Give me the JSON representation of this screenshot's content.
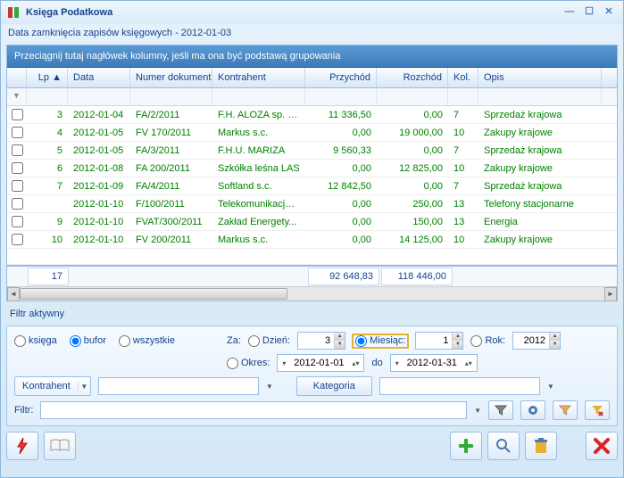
{
  "title": "Księga Podatkowa",
  "subtitle": "Data zamknięcia zapisów księgowych - 2012-01-03",
  "group_hint": "Przeciągnij tutaj nagłówek kolumny, jeśli ma ona być podstawą grupowania",
  "columns": {
    "lp": "Lp",
    "data": "Data",
    "numer": "Numer dokumentu",
    "kontrahent": "Kontrahent",
    "przychod": "Przychód",
    "rozchod": "Rozchód",
    "kol": "Kol.",
    "opis": "Opis"
  },
  "rows": [
    {
      "lp": "3",
      "data": "2012-01-04",
      "num": "FA/2/2011",
      "kon": "F.H. ALOZA sp. z...",
      "prz": "11 336,50",
      "roz": "0,00",
      "kol": "7",
      "opis": "Sprzedaż krajowa"
    },
    {
      "lp": "4",
      "data": "2012-01-05",
      "num": "FV 170/2011",
      "kon": "Markus s.c.",
      "prz": "0,00",
      "roz": "19 000,00",
      "kol": "10",
      "opis": "Zakupy krajowe"
    },
    {
      "lp": "5",
      "data": "2012-01-05",
      "num": "FA/3/2011",
      "kon": "F.H.U. MARIZA",
      "prz": "9 560,33",
      "roz": "0,00",
      "kol": "7",
      "opis": "Sprzedaż krajowa"
    },
    {
      "lp": "6",
      "data": "2012-01-08",
      "num": "FA 200/2011",
      "kon": "Szkółka leśna LAS",
      "prz": "0,00",
      "roz": "12 825,00",
      "kol": "10",
      "opis": "Zakupy krajowe"
    },
    {
      "lp": "7",
      "data": "2012-01-09",
      "num": "FA/4/2011",
      "kon": "Softland s.c.",
      "prz": "12 842,50",
      "roz": "0,00",
      "kol": "7",
      "opis": "Sprzedaż krajowa"
    },
    {
      "lp": "",
      "data": "2012-01-10",
      "num": "F/100/2011",
      "kon": "Telekomunikacja ...",
      "prz": "0,00",
      "roz": "250,00",
      "kol": "13",
      "opis": "Telefony stacjonarne"
    },
    {
      "lp": "9",
      "data": "2012-01-10",
      "num": "FVAT/300/2011",
      "kon": "Zakład Energety...",
      "prz": "0,00",
      "roz": "150,00",
      "kol": "13",
      "opis": "Energia"
    },
    {
      "lp": "10",
      "data": "2012-01-10",
      "num": "FV 200/2011",
      "kon": "Markus s.c.",
      "prz": "0,00",
      "roz": "14 125,00",
      "kol": "10",
      "opis": "Zakupy krajowe"
    }
  ],
  "totals": {
    "count": "17",
    "przychod": "92 648,83",
    "rozchod": "118 446,00"
  },
  "filter_active": "Filtr aktywny",
  "scope": {
    "ksiega": "księga",
    "bufor": "bufor",
    "wszystkie": "wszystkie"
  },
  "period": {
    "za": "Za:",
    "dzien": "Dzień:",
    "dzien_val": "3",
    "miesiac": "Miesiąc:",
    "miesiac_val": "1",
    "rok": "Rok:",
    "rok_val": "2012",
    "okres": "Okres:",
    "from": "2012-01-01",
    "do": "do",
    "to": "2012-01-31"
  },
  "kontrahent_btn": "Kontrahent",
  "kategoria_btn": "Kategoria",
  "filtr_label": "Filtr:"
}
